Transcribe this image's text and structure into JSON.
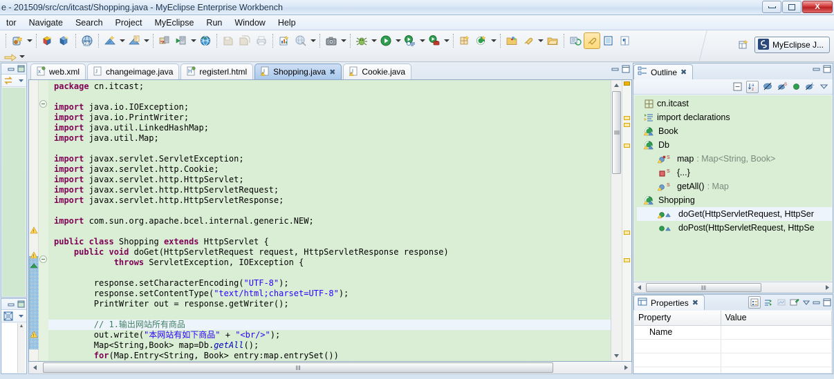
{
  "window": {
    "title": "e - 201509/src/cn/itcast/Shopping.java - MyEclipse Enterprise Workbench",
    "minimize_label": "Minimize",
    "maximize_label": "Restore",
    "close_label": "X"
  },
  "menubar": {
    "items": [
      "tor",
      "Navigate",
      "Search",
      "Project",
      "MyEclipse",
      "Run",
      "Window",
      "Help"
    ]
  },
  "toolbar": {
    "perspective_open_label": "open-perspective",
    "perspective_current": "MyEclipse J...",
    "icons": [
      "new-wizard-icon",
      "new-wizard-dropdown",
      "open-type-icon",
      "open-resource-icon",
      "web-20-icon",
      "deploy-icon",
      "deploy-dropdown",
      "run-server-icon",
      "run-server-dropdown",
      "db-explorer-icon",
      "run-config-icon",
      "browser-icon",
      "save-icon",
      "save-all-icon",
      "print-icon",
      "report-icon",
      "globe-icon",
      "globe-dropdown",
      "screenshot-icon",
      "screenshot-dropdown",
      "debug-icon",
      "debug-dropdown",
      "run-icon",
      "run-dropdown",
      "run-history-icon",
      "run-history-dropdown",
      "external-tools-icon",
      "external-tools-dropdown",
      "new-package-icon",
      "new-class-icon",
      "new-class-dropdown",
      "open-folder-icon",
      "pin-icon",
      "pin-dropdown",
      "folder-icon",
      "next-annotation-icon",
      "toggle-mark-occurrences-icon",
      "toggle-block-selection-icon",
      "show-whitespace-icon"
    ],
    "row2_icons": [
      "forward-arrow-icon",
      "forward-dropdown"
    ]
  },
  "editor": {
    "tabs": [
      {
        "label": "web.xml",
        "icon": "xml-file-icon",
        "active": false,
        "closable": false
      },
      {
        "label": "changeimage.java",
        "icon": "java-file-icon",
        "active": false,
        "closable": false
      },
      {
        "label": "registerl.html",
        "icon": "html-file-icon",
        "active": false,
        "closable": false
      },
      {
        "label": "Shopping.java",
        "icon": "java-warning-file-icon",
        "active": true,
        "closable": true,
        "close_glyph": "✖"
      },
      {
        "label": "Cookie.java",
        "icon": "java-warning-file-icon",
        "active": false,
        "closable": false
      }
    ],
    "minimize_label": "Minimize",
    "maximize_label": "Maximize",
    "code_lines": [
      {
        "indent": 0,
        "tokens": [
          {
            "t": "package ",
            "c": "kw"
          },
          {
            "t": "cn.itcast;",
            "c": ""
          }
        ]
      },
      {
        "indent": 0,
        "tokens": []
      },
      {
        "indent": 0,
        "tokens": [
          {
            "t": "import ",
            "c": "kw"
          },
          {
            "t": "java.io.IOException;",
            "c": ""
          }
        ]
      },
      {
        "indent": 0,
        "tokens": [
          {
            "t": "import ",
            "c": "kw"
          },
          {
            "t": "java.io.PrintWriter;",
            "c": ""
          }
        ]
      },
      {
        "indent": 0,
        "tokens": [
          {
            "t": "import ",
            "c": "kw"
          },
          {
            "t": "java.util.LinkedHashMap;",
            "c": ""
          }
        ]
      },
      {
        "indent": 0,
        "tokens": [
          {
            "t": "import ",
            "c": "kw"
          },
          {
            "t": "java.util.Map;",
            "c": ""
          }
        ]
      },
      {
        "indent": 0,
        "tokens": []
      },
      {
        "indent": 0,
        "tokens": [
          {
            "t": "import ",
            "c": "kw"
          },
          {
            "t": "javax.servlet.ServletException;",
            "c": ""
          }
        ]
      },
      {
        "indent": 0,
        "tokens": [
          {
            "t": "import ",
            "c": "kw"
          },
          {
            "t": "javax.servlet.http.Cookie;",
            "c": ""
          }
        ]
      },
      {
        "indent": 0,
        "tokens": [
          {
            "t": "import ",
            "c": "kw"
          },
          {
            "t": "javax.servlet.http.HttpServlet;",
            "c": ""
          }
        ]
      },
      {
        "indent": 0,
        "tokens": [
          {
            "t": "import ",
            "c": "kw"
          },
          {
            "t": "javax.servlet.http.HttpServletRequest;",
            "c": ""
          }
        ]
      },
      {
        "indent": 0,
        "tokens": [
          {
            "t": "import ",
            "c": "kw"
          },
          {
            "t": "javax.servlet.http.HttpServletResponse;",
            "c": ""
          }
        ]
      },
      {
        "indent": 0,
        "tokens": []
      },
      {
        "indent": 0,
        "tokens": [
          {
            "t": "import ",
            "c": "kw"
          },
          {
            "t": "com.sun.org.apache.bcel.internal.generic.NEW;",
            "c": ""
          }
        ]
      },
      {
        "indent": 0,
        "tokens": []
      },
      {
        "indent": 0,
        "tokens": [
          {
            "t": "public class ",
            "c": "kw"
          },
          {
            "t": "Shopping ",
            "c": ""
          },
          {
            "t": "extends ",
            "c": "kw"
          },
          {
            "t": "HttpServlet {",
            "c": ""
          }
        ]
      },
      {
        "indent": 1,
        "tokens": [
          {
            "t": "public void ",
            "c": "kw"
          },
          {
            "t": "doGet(HttpServletRequest request, HttpServletResponse response)",
            "c": ""
          }
        ]
      },
      {
        "indent": 3,
        "tokens": [
          {
            "t": "throws ",
            "c": "kw"
          },
          {
            "t": "ServletException, IOException {",
            "c": ""
          }
        ]
      },
      {
        "indent": 0,
        "tokens": []
      },
      {
        "indent": 2,
        "tokens": [
          {
            "t": "response.setCharacterEncoding(",
            "c": ""
          },
          {
            "t": "\"UTF-8\"",
            "c": "str"
          },
          {
            "t": ");",
            "c": ""
          }
        ]
      },
      {
        "indent": 2,
        "tokens": [
          {
            "t": "response.setContentType(",
            "c": ""
          },
          {
            "t": "\"text/html;charset=UTF-8\"",
            "c": "str"
          },
          {
            "t": ");",
            "c": ""
          }
        ]
      },
      {
        "indent": 2,
        "tokens": [
          {
            "t": "PrintWriter out = response.getWriter();",
            "c": ""
          }
        ]
      },
      {
        "indent": 0,
        "tokens": []
      },
      {
        "indent": 2,
        "current": true,
        "tokens": [
          {
            "t": "// 1.输出网站所有商品",
            "c": "cmt"
          }
        ]
      },
      {
        "indent": 2,
        "tokens": [
          {
            "t": "out.write(",
            "c": ""
          },
          {
            "t": "\"本网站有如下商品\"",
            "c": "str"
          },
          {
            "t": " + ",
            "c": ""
          },
          {
            "t": "\"<br/>\"",
            "c": "str"
          },
          {
            "t": ");",
            "c": ""
          }
        ]
      },
      {
        "indent": 2,
        "tokens": [
          {
            "t": "Map<String,Book> map=Db.",
            "c": ""
          },
          {
            "t": "getAll",
            "c": "fld"
          },
          {
            "t": "();",
            "c": ""
          }
        ]
      },
      {
        "indent": 2,
        "tokens": [
          {
            "t": "for",
            "c": "kw"
          },
          {
            "t": "(Map.Entry<String, Book> entry:map.entrySet())",
            "c": ""
          }
        ]
      }
    ],
    "hscroll_grip": "‖‖"
  },
  "outline": {
    "tab_label": "Outline",
    "close_glyph": "✖",
    "tools": [
      "collapse-all-icon",
      "sort-icon",
      "hide-fields-icon",
      "hide-static-icon",
      "hide-nonpublic-icon",
      "view-menu-icon"
    ],
    "items": [
      {
        "label": "cn.itcast",
        "icon": "package-icon",
        "level": 0,
        "type": "",
        "selected": false
      },
      {
        "label": "import declarations",
        "icon": "imports-icon",
        "level": 0,
        "type": "",
        "selected": false
      },
      {
        "label": "Book",
        "icon": "class-warning-icon",
        "level": 0,
        "type": "",
        "selected": false
      },
      {
        "label": "Db",
        "icon": "class-warning-icon",
        "level": 0,
        "type": "",
        "selected": false
      },
      {
        "label": "map",
        "icon": "field-static-icon",
        "level": 1,
        "type": " : Map<String, Book>",
        "selected": false
      },
      {
        "label": "{...}",
        "icon": "static-initializer-icon",
        "level": 1,
        "type": "",
        "selected": false
      },
      {
        "label": "getAll()",
        "icon": "method-static-icon",
        "level": 1,
        "type": " : Map",
        "selected": false
      },
      {
        "label": "Shopping",
        "icon": "class-warning-icon",
        "level": 0,
        "type": "",
        "selected": false
      },
      {
        "label": "doGet(HttpServletRequest, HttpSer",
        "icon": "method-warning-icon",
        "level": 1,
        "type": "",
        "selected": true
      },
      {
        "label": "doPost(HttpServletRequest, HttpSe",
        "icon": "method-public-icon",
        "level": 1,
        "type": "",
        "selected": false
      }
    ],
    "hscroll_grip": "‖‖"
  },
  "properties": {
    "tab_label": "Properties",
    "close_glyph": "✖",
    "tools": [
      "show-categories-icon",
      "show-advanced-icon",
      "restore-defaults-icon",
      "pin-icon",
      "view-menu-icon"
    ],
    "columns": [
      "Property",
      "Value"
    ],
    "rows": [
      {
        "property": "Name",
        "value": ""
      },
      {
        "property": "",
        "value": ""
      },
      {
        "property": "",
        "value": ""
      },
      {
        "property": "",
        "value": ""
      }
    ]
  },
  "left_panels": {
    "top": {
      "icon": "sync-arrows-icon",
      "menu": "view-menu-icon"
    },
    "bottom": {
      "icon": "variables-grid-icon",
      "menu": "view-menu-icon"
    }
  },
  "colors": {
    "code_bg": "#d9eed4",
    "current_line": "#eef4fb",
    "keyword": "#7f0055",
    "string": "#2a00ff",
    "comment": "#3f7f5f",
    "tab_active": "#a9c8ec",
    "view_bg": "#d9eed4"
  }
}
